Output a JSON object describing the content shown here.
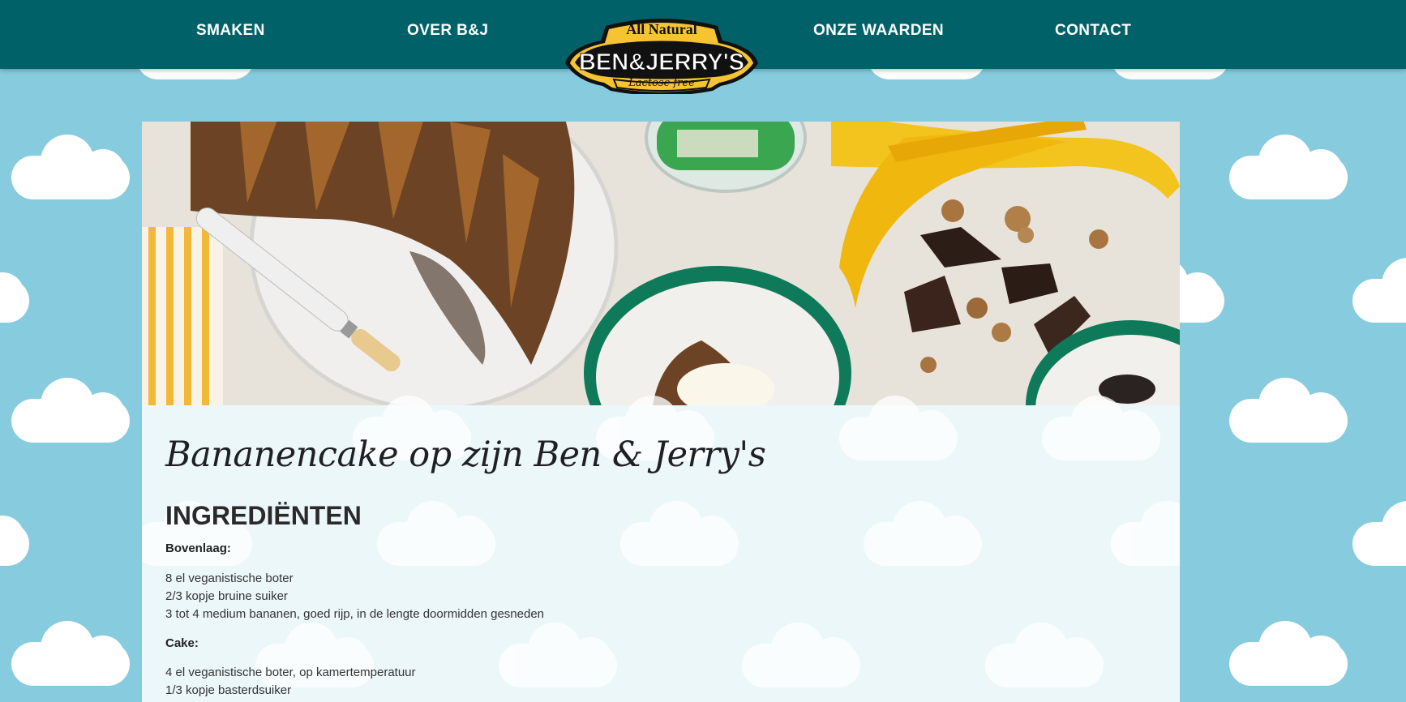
{
  "nav": {
    "links": [
      "SMAKEN",
      "OVER B&J",
      "ONZE WAARDEN",
      "CONTACT"
    ]
  },
  "logo": {
    "top": "All Natural",
    "brand": "BEN&JERRY'S",
    "bottom": "Lactose free"
  },
  "recipe": {
    "title": "Bananencake op zijn Ben & Jerry's",
    "ingredients_heading": "INGREDIËNTEN",
    "sections": [
      {
        "name": "Bovenlaag:",
        "items": [
          "8 el veganistische boter",
          "2/3 kopje bruine suiker",
          "3 tot 4 medium bananen, goed rijp, in de lengte doormidden gesneden"
        ]
      },
      {
        "name": "Cake:",
        "items": [
          "4 el veganistische boter, op kamertemperatuur",
          "1/3 kopje basterdsuiker"
        ]
      }
    ]
  },
  "colors": {
    "nav": "#006168",
    "sky": "#86cbde",
    "logo_yellow": "#f6c432"
  }
}
